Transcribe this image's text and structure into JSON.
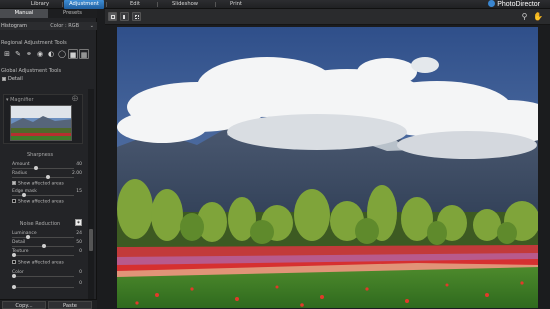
{
  "topbar": {
    "tabs": [
      {
        "label": "Library",
        "active": false
      },
      {
        "label": "Adjustment",
        "active": true
      },
      {
        "label": "Edit",
        "active": false
      },
      {
        "label": "Slideshow",
        "active": false
      },
      {
        "label": "Print",
        "active": false
      }
    ],
    "brand": "PhotoDirector"
  },
  "panel": {
    "mode_tabs": [
      {
        "label": "Manual",
        "active": true
      },
      {
        "label": "Presets",
        "active": false
      }
    ],
    "histogram": {
      "label": "Histogram",
      "color_label": "Color : RGB"
    },
    "regional_tools_label": "Regional Adjustment Tools",
    "global_tools_label": "Global Adjustment Tools",
    "detail_label": "Detail",
    "magnifier_label": "Magnifier",
    "sharpness": {
      "title": "Sharpness",
      "amount": {
        "label": "Amount",
        "value": "40"
      },
      "radius": {
        "label": "Radius",
        "value": "2.00"
      },
      "show_affected": "Show affected areas",
      "edge_mask": {
        "label": "Edge mask",
        "value": "15"
      }
    },
    "noise_reduction": {
      "title": "Noise Reduction",
      "luminance": {
        "label": "Luminance",
        "value": "24"
      },
      "detail": {
        "label": "Detail",
        "value": "50"
      },
      "texture": {
        "label": "Texture",
        "value": "0"
      },
      "show_affected": "Show affected areas",
      "color": {
        "label": "Color",
        "value": "0"
      },
      "extra": {
        "label": "",
        "value": "0"
      }
    },
    "copy_label": "Copy...",
    "paste_label": "Paste"
  },
  "colors": {
    "accent": "#2f7fcf",
    "panel_bg": "#232427",
    "app_bg": "#1b1c1e"
  }
}
